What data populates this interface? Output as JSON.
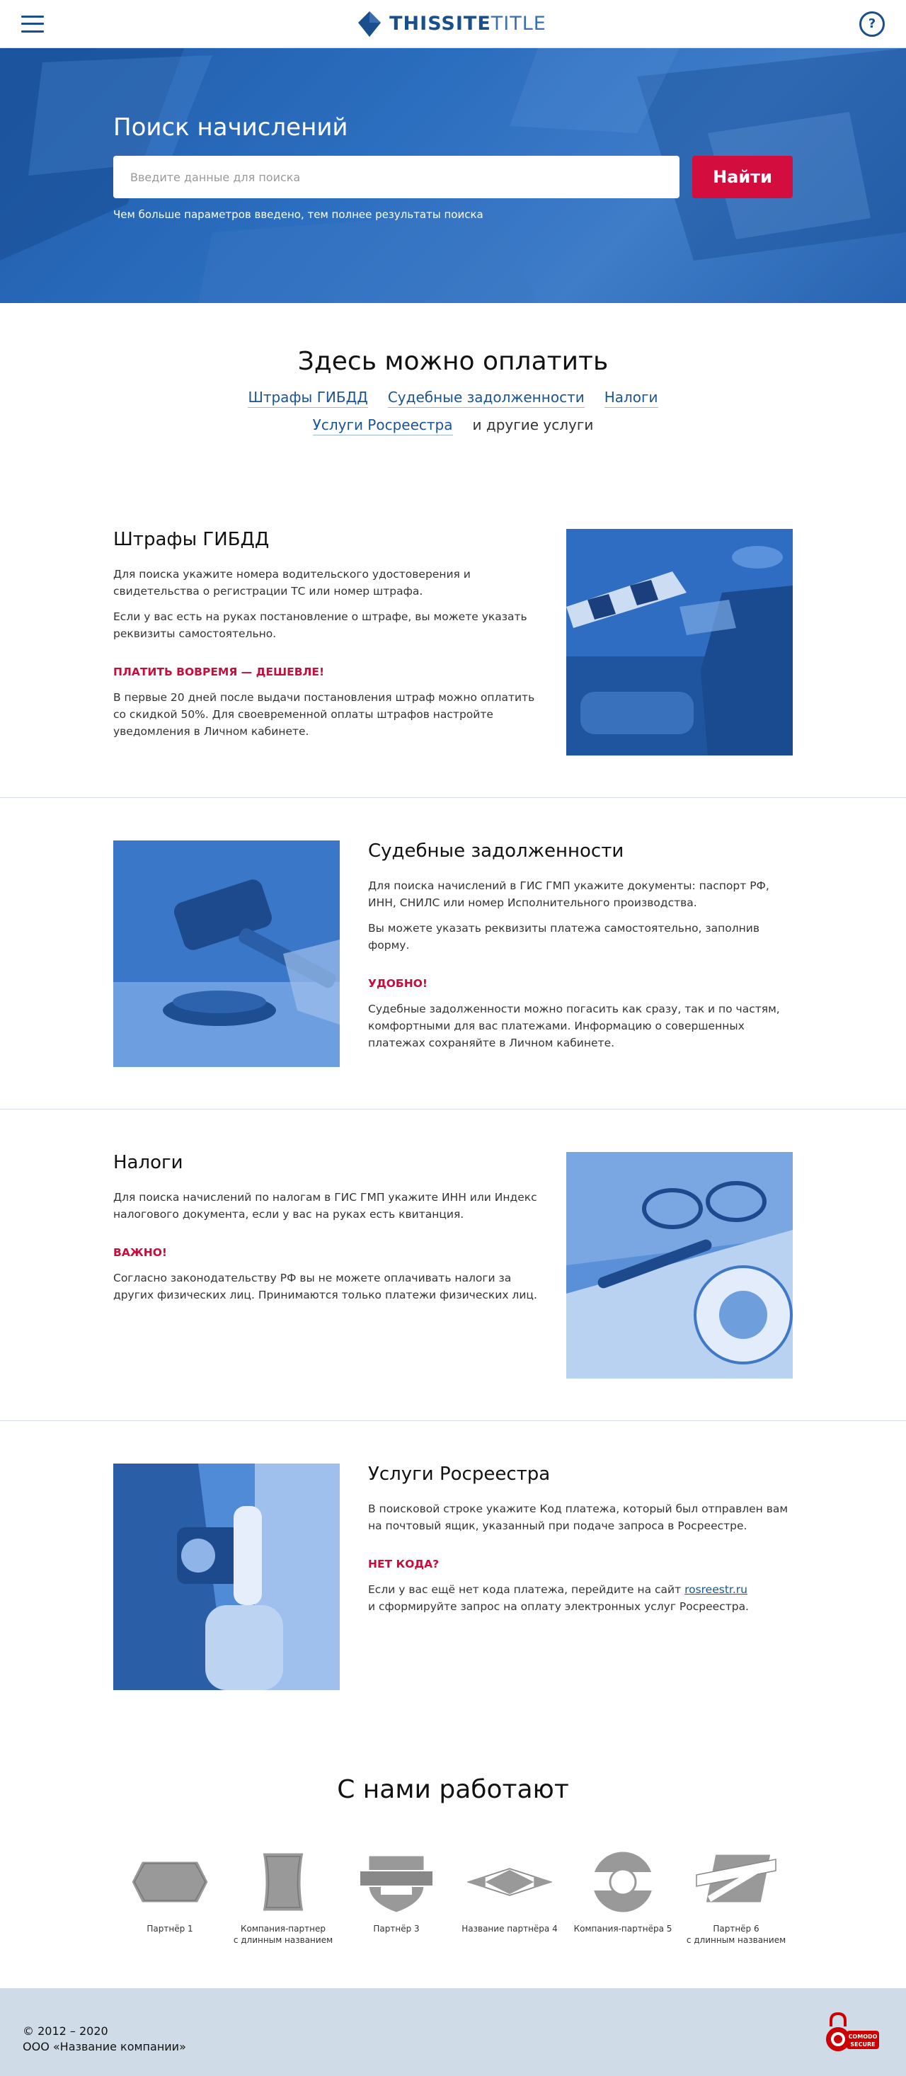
{
  "header": {
    "logo_bold": "THISSITE",
    "logo_light": "TITLE",
    "help_label": "?"
  },
  "hero": {
    "title": "Поиск начислений",
    "search_placeholder": "Введите данные для поиска",
    "search_button": "Найти",
    "hint": "Чем больше параметров введено, тем полнее результаты поиска"
  },
  "pay": {
    "title": "Здесь можно оплатить",
    "links": [
      "Штрафы ГИБДД",
      "Судебные задолженности",
      "Налоги",
      "Услуги Росреестра"
    ],
    "other": "и другие услуги"
  },
  "services": {
    "gibdd": {
      "title": "Штрафы ГИБДД",
      "p1": "Для поиска укажите номера водительского удостоверения и свидетельства о регистрации ТС или номер штрафа.",
      "p2": "Если у вас есть на руках постановление о штрафе, вы можете указать реквизиты самостоятельно.",
      "accent": "ПЛАТИТЬ ВОВРЕМЯ — ДЕШЕВЛЕ!",
      "p3": "В первые 20 дней после выдачи постановления штраф можно оплатить со скидкой 50%.  Для своевременной оплаты штрафов настройте уведомления в Личном кабинете."
    },
    "court": {
      "title": "Судебные задолженности",
      "p1": "Для поиска начислений в ГИС ГМП укажите документы: паспорт РФ, ИНН, СНИЛС или номер Исполнительного производства.",
      "p2": "Вы можете указать реквизиты платежа самостоятельно, заполнив форму.",
      "accent": "УДОБНО!",
      "p3": "Судебные задолженности можно погасить как сразу, так и по частям, комфортными для вас платежами. Информацию о совершенных платежах сохраняйте в Личном кабинете."
    },
    "tax": {
      "title": "Налоги",
      "p1": "Для поиска начислений по налогам в ГИС ГМП укажите ИНН или Индекс налогового документа, если у вас на руках есть квитанция.",
      "accent": "ВАЖНО!",
      "p3": "Согласно законодательству РФ вы не можете оплачивать налоги за других физических лиц. Принимаются только платежи физических лиц."
    },
    "rosreestr": {
      "title": "Услуги Росреестра",
      "p1": "В поисковой строке укажите Код платежа, который был отправлен вам на почтовый ящик, указанный при подаче запроса в Росреестре.",
      "accent": "НЕТ КОДА?",
      "p3_before": "Если у вас ещё нет кода платежа, перейдите на сайт ",
      "p3_link": "rosreestr.ru",
      "p3_after": "и сформируйте запрос на оплату электронных услуг Росреестра."
    }
  },
  "partners": {
    "title": "С нами работают",
    "items": [
      {
        "line1": "Партнёр 1",
        "line2": ""
      },
      {
        "line1": "Компания-партнер",
        "line2": "с длинным названием"
      },
      {
        "line1": "Партнёр 3",
        "line2": ""
      },
      {
        "line1": "Название партнёра 4",
        "line2": ""
      },
      {
        "line1": "Компания-партнёра 5",
        "line2": ""
      },
      {
        "line1": "Партнёр 6",
        "line2": "с длинным названием"
      }
    ]
  },
  "footer": {
    "copyright": "© 2012 – 2020",
    "company": "ООО «Название компании»",
    "badge_top": "COMODO",
    "badge_bottom": "SECURE"
  }
}
